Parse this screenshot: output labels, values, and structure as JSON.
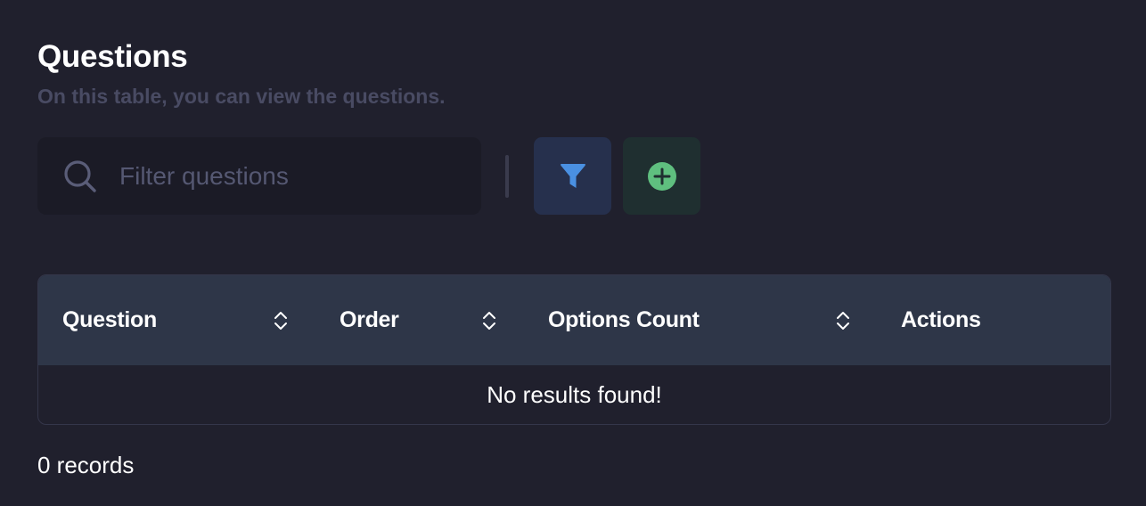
{
  "header": {
    "title": "Questions",
    "subtitle": "On this table, you can view the questions."
  },
  "toolbar": {
    "search_placeholder": "Filter questions",
    "search_value": "",
    "search_icon": "search-icon",
    "filter_icon": "funnel-icon",
    "add_icon": "plus-circle-icon"
  },
  "table": {
    "columns": [
      {
        "label": "Question",
        "sortable": true
      },
      {
        "label": "Order",
        "sortable": true
      },
      {
        "label": "Options Count",
        "sortable": true
      },
      {
        "label": "Actions",
        "sortable": false
      }
    ],
    "rows": [],
    "empty_message": "No results found!"
  },
  "footer": {
    "records_text": "0 records"
  },
  "colors": {
    "background": "#20202d",
    "header_row": "#2e3648",
    "filter_accent": "#4a90e2",
    "add_accent": "#5fbf7f"
  }
}
